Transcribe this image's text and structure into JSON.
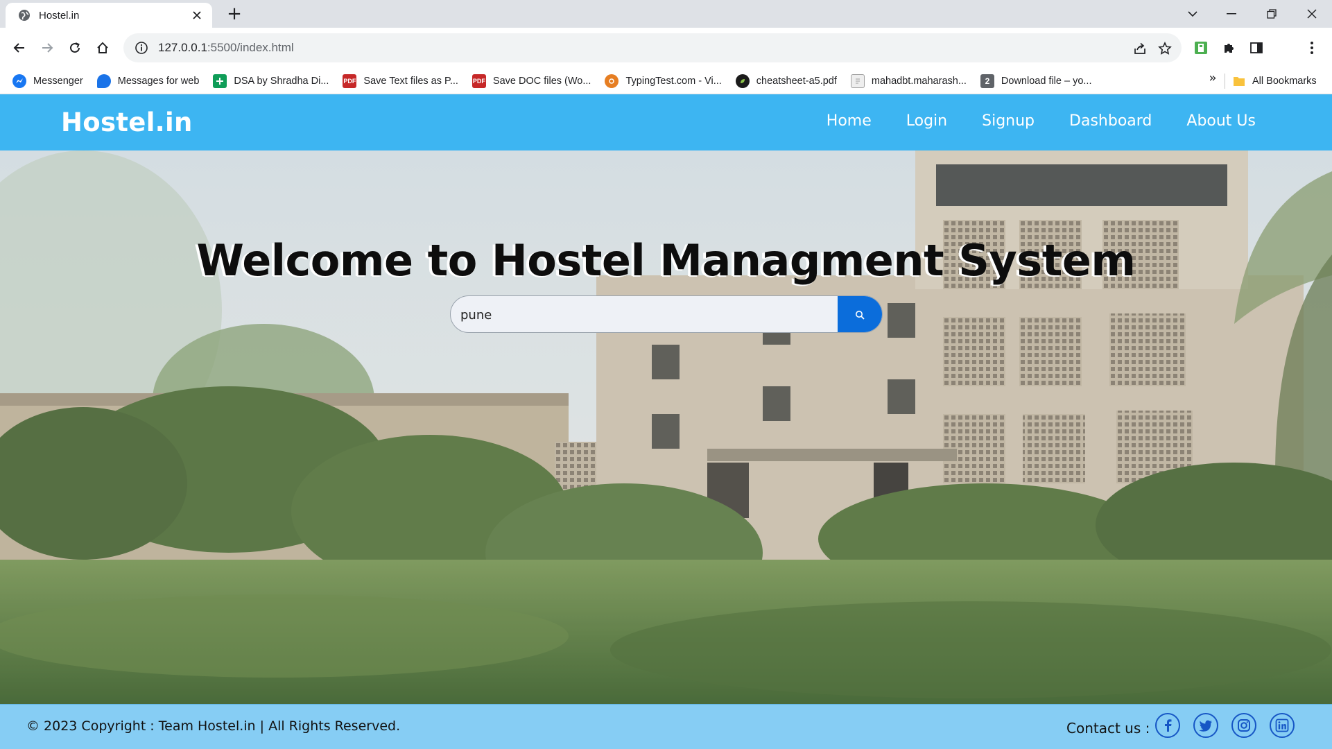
{
  "browser": {
    "tab_title": "Hostel.in",
    "new_tab_symbol": "+",
    "url_host": "127.0.0.1",
    "url_path": ":5500/index.html",
    "bookmarks": [
      {
        "label": "Messenger",
        "icon": "messenger-icon",
        "color": "#1877f2"
      },
      {
        "label": "Messages for web",
        "icon": "messages-icon",
        "color": "#1a73e8"
      },
      {
        "label": "DSA by Shradha Di...",
        "icon": "sheets-icon",
        "color": "#0f9d58"
      },
      {
        "label": "Save Text files as P...",
        "icon": "pdf-icon",
        "color": "#c62828"
      },
      {
        "label": "Save DOC files (Wo...",
        "icon": "pdf-icon",
        "color": "#c62828"
      },
      {
        "label": "TypingTest.com - Vi...",
        "icon": "typingtest-icon",
        "color": "#e67e22"
      },
      {
        "label": "cheatsheet-a5.pdf",
        "icon": "leaf-icon",
        "color": "#1b1b1b"
      },
      {
        "label": "mahadbt.maharash...",
        "icon": "document-icon",
        "color": "#9e9e9e"
      },
      {
        "label": "Download file – yo...",
        "icon": "download-file-icon",
        "color": "#5f6368"
      }
    ],
    "bookmarks_overflow": "»",
    "all_bookmarks": "All Bookmarks"
  },
  "site": {
    "brand": "Hostel.in",
    "nav": [
      "Home",
      "Login",
      "Signup",
      "Dashboard",
      "About Us"
    ],
    "headline": "Welcome to  Hostel Managment System",
    "search": {
      "value": "pune",
      "placeholder": ""
    },
    "footer": {
      "copyright": "© 2023 Copyright : Team Hostel.in | All Rights Reserved.",
      "contact_label": "Contact us :",
      "social": [
        "facebook-icon",
        "twitter-icon",
        "instagram-icon",
        "linkedin-icon"
      ]
    }
  },
  "colors": {
    "navbar": "#3db5f2",
    "footer": "#86cdf4",
    "search_button": "#0b6ddb",
    "social_icon": "#1656c5"
  }
}
